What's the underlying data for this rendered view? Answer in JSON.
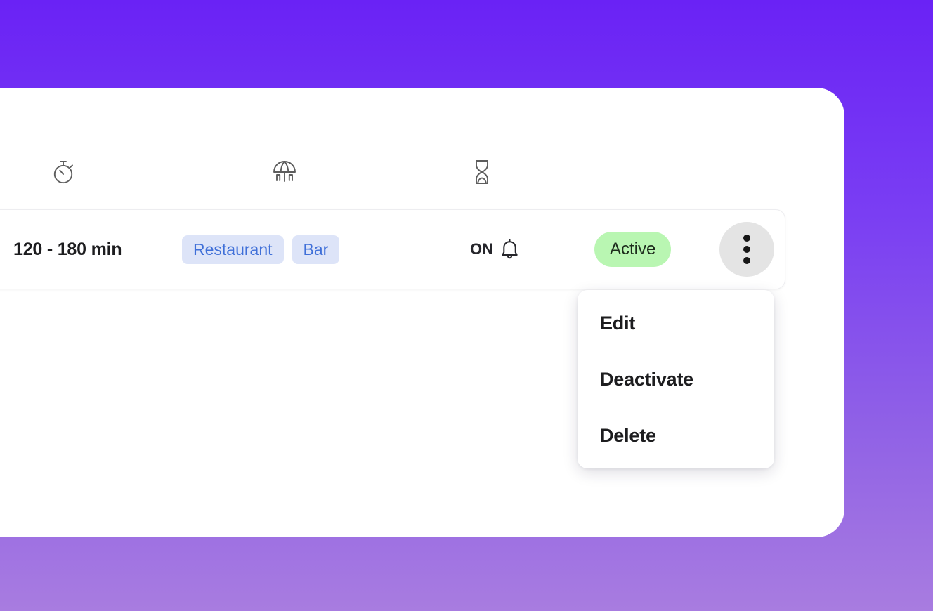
{
  "theme": {
    "background_gradient_from": "#6a22f5",
    "background_gradient_to": "#a87ce0",
    "panel_background": "#ffffff",
    "tag_chip_background": "#dde4f8",
    "tag_chip_text": "#3f6fd8",
    "status_badge_background": "#b9f6b2",
    "kebab_button_background": "#e4e4e4"
  },
  "header": {
    "icons": [
      {
        "name": "stopwatch-icon",
        "label": "stopwatch"
      },
      {
        "name": "beach-umbrella-icon",
        "label": "beach-umbrella"
      },
      {
        "name": "hourglass-icon",
        "label": "hourglass"
      }
    ]
  },
  "row": {
    "duration": "120 - 180 min",
    "tags": [
      "Restaurant",
      "Bar"
    ],
    "notification": {
      "label": "ON",
      "icon": "bell-icon"
    },
    "status": "Active",
    "actions_icon": "kebab-menu-icon"
  },
  "dropdown": {
    "items": [
      {
        "label": "Edit",
        "name": "menu-item-edit"
      },
      {
        "label": "Deactivate",
        "name": "menu-item-deactivate"
      },
      {
        "label": "Delete",
        "name": "menu-item-delete"
      }
    ]
  }
}
